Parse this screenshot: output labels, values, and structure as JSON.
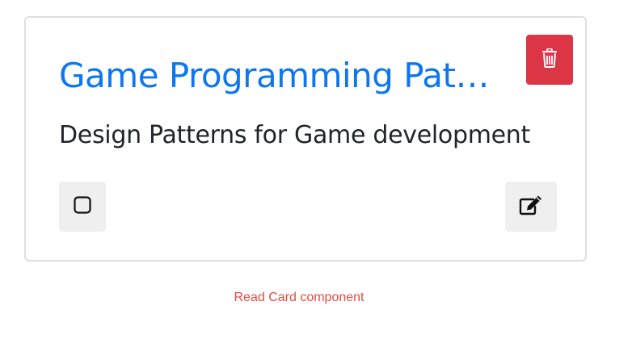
{
  "card": {
    "title": "Game Programming Patterns",
    "description": "Design Patterns for Game development",
    "delete_icon": "trash-icon",
    "checkbox_icon": "square-outline-icon",
    "edit_icon": "edit-pencil-icon"
  },
  "caption": "Read Card component",
  "colors": {
    "title": "#0d76f0",
    "delete_button": "#dc3545",
    "caption": "#e84a3f",
    "secondary_button": "#efefef"
  }
}
